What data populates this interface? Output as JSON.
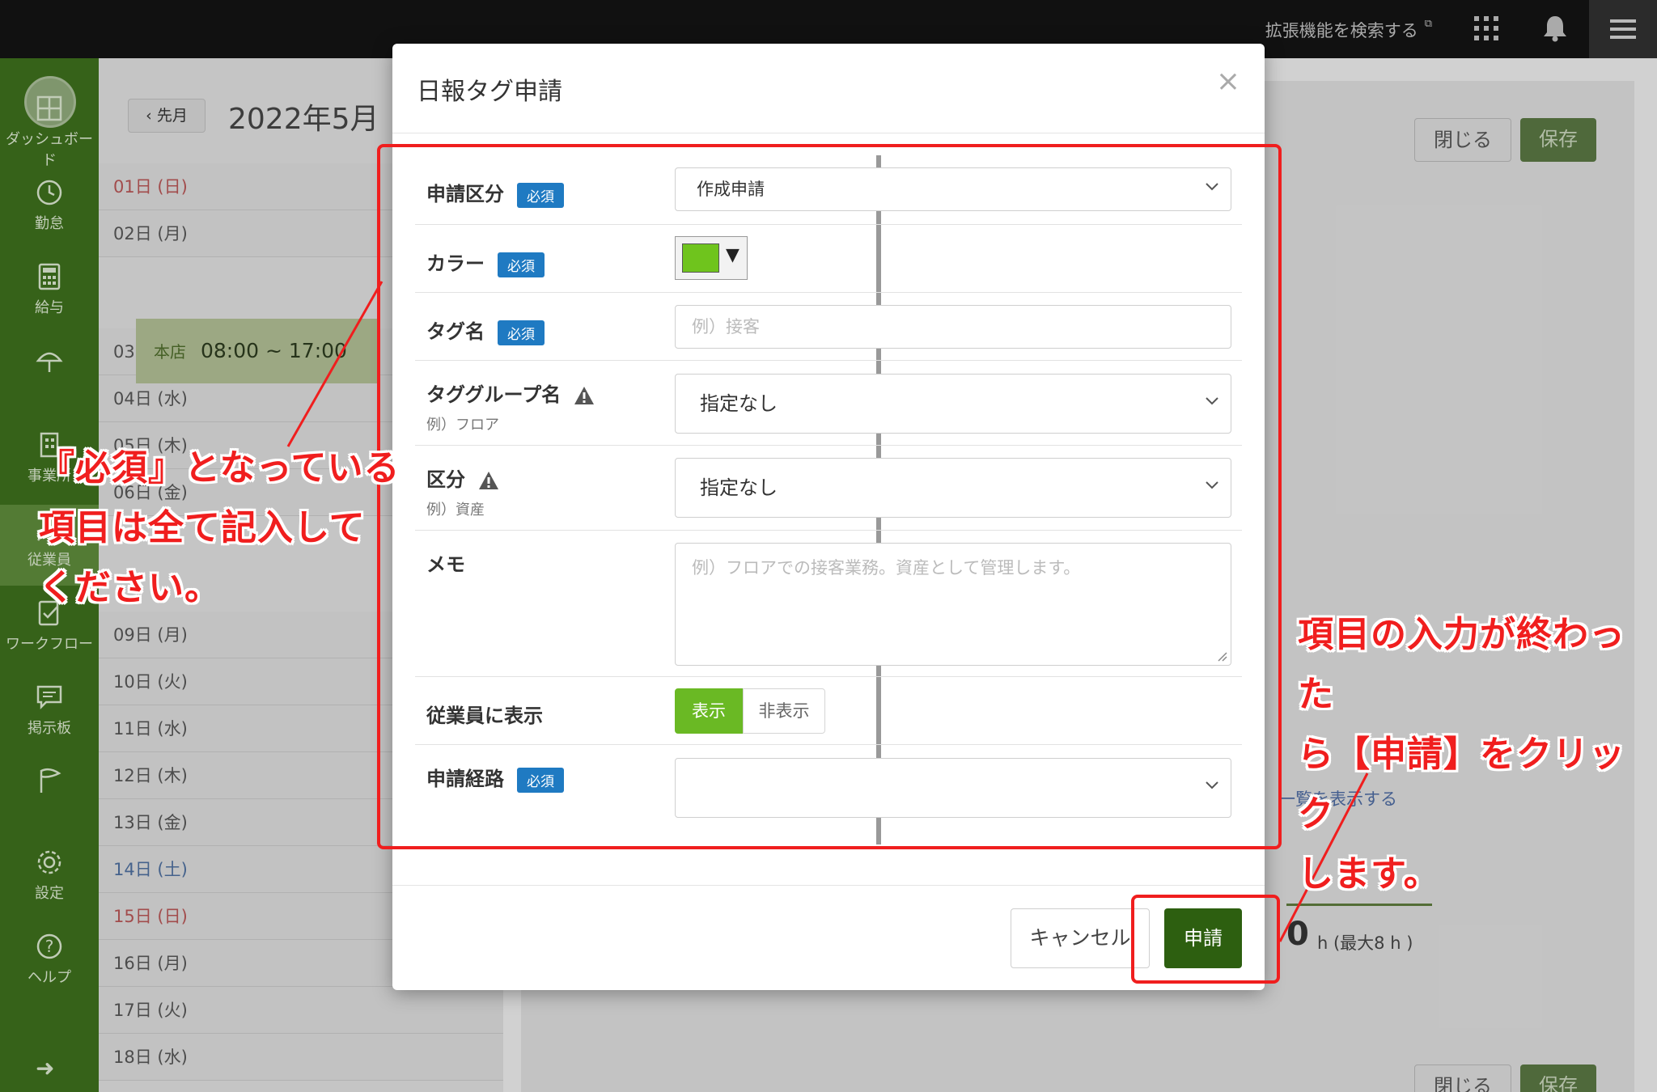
{
  "topbar": {
    "extensions_label": "拡張機能を検索する"
  },
  "sidebar": {
    "items": [
      {
        "label": "ダッシュボード",
        "icon": "dashboard-icon"
      },
      {
        "label": "勤怠",
        "icon": "clock-icon"
      },
      {
        "label": "給与",
        "icon": "calculator-icon"
      },
      {
        "label": "",
        "icon": "umbrella-icon"
      },
      {
        "label": "事業所",
        "icon": "building-icon"
      },
      {
        "label": "従業員",
        "icon": "person-icon"
      },
      {
        "label": "ワークフロー",
        "icon": "checklist-icon"
      },
      {
        "label": "掲示板",
        "icon": "chat-icon"
      },
      {
        "label": "",
        "icon": "flag-icon"
      },
      {
        "label": "設定",
        "icon": "gear-icon"
      },
      {
        "label": "ヘルプ",
        "icon": "help-icon"
      }
    ]
  },
  "calendar": {
    "prev_label": "先月",
    "month": "2022年5月",
    "shift_shop": "本店",
    "shift_time": "08:00 ~ 17:00",
    "days": [
      {
        "label": "01日 (日)",
        "kind": "sun"
      },
      {
        "label": "02日 (月)",
        "kind": "day"
      },
      {
        "label": "03日 (火)",
        "kind": "day"
      },
      {
        "label": "04日 (水)",
        "kind": "day"
      },
      {
        "label": "05日 (木)",
        "kind": "day"
      },
      {
        "label": "06日 (金)",
        "kind": "day"
      },
      {
        "label": "09日 (月)",
        "kind": "day"
      },
      {
        "label": "10日 (火)",
        "kind": "day"
      },
      {
        "label": "11日 (水)",
        "kind": "day"
      },
      {
        "label": "12日 (木)",
        "kind": "day"
      },
      {
        "label": "13日 (金)",
        "kind": "day"
      },
      {
        "label": "14日 (土)",
        "kind": "sat"
      },
      {
        "label": "15日 (日)",
        "kind": "sun"
      },
      {
        "label": "16日 (月)",
        "kind": "day"
      },
      {
        "label": "17日 (火)",
        "kind": "day"
      },
      {
        "label": "18日 (水)",
        "kind": "day"
      }
    ]
  },
  "background": {
    "close_label": "閉じる",
    "save_label": "保存",
    "list_link": "一覧を表示する",
    "hours_value": "0",
    "hours_unit": "h (最大8 h )"
  },
  "modal": {
    "title": "日報タグ申請",
    "close_symbol": "×",
    "required_badge": "必須",
    "fields": {
      "request_type": {
        "label": "申請区分",
        "value": "作成申請"
      },
      "color": {
        "label": "カラー",
        "value": "#6fc41d"
      },
      "tag_name": {
        "label": "タグ名",
        "placeholder": "例）接客"
      },
      "tag_group": {
        "label": "タググループ名",
        "hint": "例）フロア",
        "value": "指定なし"
      },
      "category": {
        "label": "区分",
        "hint": "例）資産",
        "value": "指定なし"
      },
      "memo": {
        "label": "メモ",
        "placeholder": "例）フロアでの接客業務。資産として管理します。"
      },
      "show_employee": {
        "label": "従業員に表示",
        "on_label": "表示",
        "off_label": "非表示"
      },
      "route": {
        "label": "申請経路",
        "value": ""
      }
    },
    "cancel_label": "キャンセル",
    "submit_label": "申請"
  },
  "annotations": {
    "left_line1": "『必須』となっている",
    "left_line2": "項目は全て記入して",
    "left_line3": "ください。",
    "right_line1": "項目の入力が終わった",
    "right_line2": "ら【申請】をクリック",
    "right_line3": "します。",
    "color": "#f01e1e"
  }
}
